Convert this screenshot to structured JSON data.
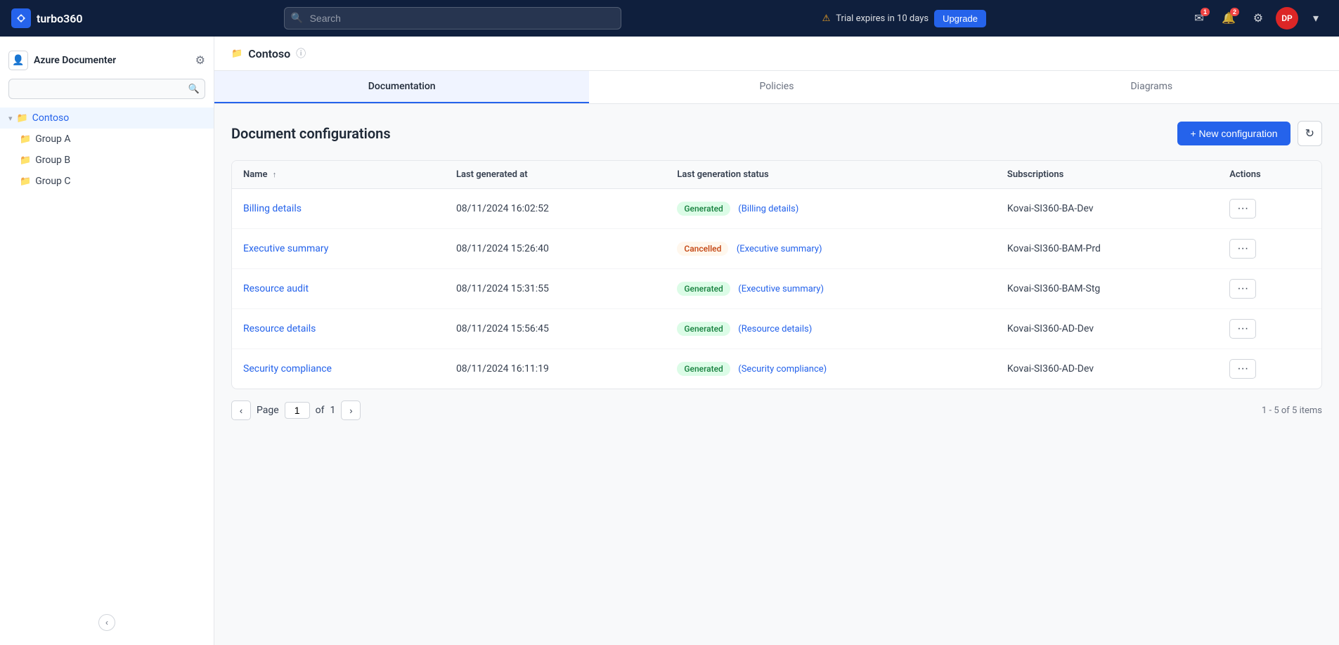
{
  "app": {
    "name": "turbo360",
    "logo_text": "turbo360"
  },
  "topnav": {
    "search_placeholder": "Search",
    "trial_text": "Trial expires in 10 days",
    "upgrade_label": "Upgrade",
    "notification_count": "2",
    "message_count": "1",
    "avatar_initials": "DP",
    "avatar_bg": "#dc2626"
  },
  "sidebar": {
    "module_name": "Azure Documenter",
    "search_placeholder": "",
    "items": [
      {
        "label": "Contoso",
        "level": 0,
        "active": true,
        "expanded": true
      },
      {
        "label": "Group A",
        "level": 1,
        "active": false
      },
      {
        "label": "Group B",
        "level": 1,
        "active": false
      },
      {
        "label": "Group C",
        "level": 1,
        "active": false
      }
    ]
  },
  "breadcrumb": {
    "folder_icon": "📁",
    "name": "Contoso"
  },
  "tabs": [
    {
      "label": "Documentation",
      "active": true
    },
    {
      "label": "Policies",
      "active": false
    },
    {
      "label": "Diagrams",
      "active": false
    }
  ],
  "content": {
    "title": "Document configurations",
    "new_config_label": "+ New configuration",
    "table": {
      "columns": [
        "Name",
        "Last generated at",
        "Last generation status",
        "Subscriptions",
        "Actions"
      ],
      "rows": [
        {
          "name": "Billing details",
          "generated_at": "08/11/2024 16:02:52",
          "status": "Generated",
          "status_type": "generated",
          "status_label": "(Billing details)",
          "subscription": "Kovai-SI360-BA-Dev"
        },
        {
          "name": "Executive summary",
          "generated_at": "08/11/2024 15:26:40",
          "status": "Cancelled",
          "status_type": "cancelled",
          "status_label": "(Executive summary)",
          "subscription": "Kovai-SI360-BAM-Prd"
        },
        {
          "name": "Resource audit",
          "generated_at": "08/11/2024 15:31:55",
          "status": "Generated",
          "status_type": "generated",
          "status_label": "(Executive summary)",
          "subscription": "Kovai-SI360-BAM-Stg"
        },
        {
          "name": "Resource details",
          "generated_at": "08/11/2024 15:56:45",
          "status": "Generated",
          "status_type": "generated",
          "status_label": "(Resource details)",
          "subscription": "Kovai-SI360-AD-Dev"
        },
        {
          "name": "Security compliance",
          "generated_at": "08/11/2024 16:11:19",
          "status": "Generated",
          "status_type": "generated",
          "status_label": "(Security compliance)",
          "subscription": "Kovai-SI360-AD-Dev"
        }
      ]
    },
    "pagination": {
      "page_label": "Page",
      "current_page": "1",
      "of_label": "of",
      "total_pages": "1",
      "items_summary": "1 - 5 of 5 items"
    }
  }
}
